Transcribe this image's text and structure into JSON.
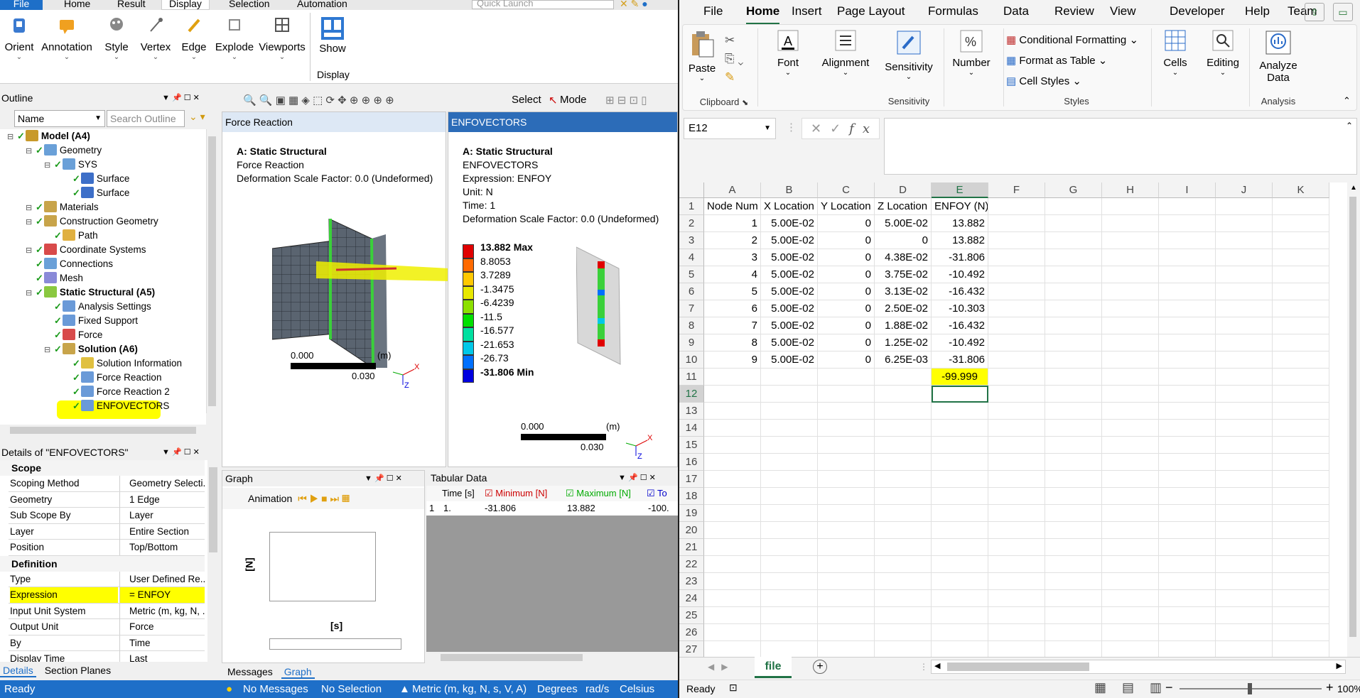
{
  "ansys": {
    "ribbon_tabs": [
      "File",
      "Home",
      "Result",
      "Display",
      "Selection",
      "Automation"
    ],
    "quick_launch_placeholder": "Quick Launch",
    "ribbon_buttons": [
      "Orient",
      "Annotation",
      "Style",
      "Vertex",
      "Edge",
      "Explode",
      "Viewports",
      "Show"
    ],
    "ribbon_group": "Display",
    "outline": {
      "title": "Outline",
      "name_filter": "Name",
      "search_placeholder": "Search Outline",
      "items": [
        {
          "label": "Model (A4)",
          "bold": true,
          "indent": 0,
          "color": "#c89a2a"
        },
        {
          "label": "Geometry",
          "indent": 1,
          "color": "#6aa0d8"
        },
        {
          "label": "SYS",
          "indent": 2,
          "color": "#6aa0d8"
        },
        {
          "label": "Surface",
          "indent": 3,
          "color": "#3d6fc8"
        },
        {
          "label": "Surface",
          "indent": 3,
          "color": "#3d6fc8"
        },
        {
          "label": "Materials",
          "indent": 1,
          "color": "#c8a44a"
        },
        {
          "label": "Construction Geometry",
          "indent": 1,
          "color": "#c8a44a"
        },
        {
          "label": "Path",
          "indent": 2,
          "color": "#e0b040"
        },
        {
          "label": "Coordinate Systems",
          "indent": 1,
          "color": "#d84a4a"
        },
        {
          "label": "Connections",
          "indent": 1,
          "color": "#6aa0d8"
        },
        {
          "label": "Mesh",
          "indent": 1,
          "color": "#8a8ad8"
        },
        {
          "label": "Static Structural (A5)",
          "bold": true,
          "indent": 1,
          "color": "#8ac840"
        },
        {
          "label": "Analysis Settings",
          "indent": 2,
          "color": "#6a9ad8"
        },
        {
          "label": "Fixed Support",
          "indent": 2,
          "color": "#6a9ad8"
        },
        {
          "label": "Force",
          "indent": 2,
          "color": "#d84a4a"
        },
        {
          "label": "Solution (A6)",
          "bold": true,
          "indent": 2,
          "color": "#c8a44a"
        },
        {
          "label": "Solution Information",
          "indent": 3,
          "color": "#e0c040"
        },
        {
          "label": "Force Reaction",
          "indent": 3,
          "color": "#6a9ad8"
        },
        {
          "label": "Force Reaction 2",
          "indent": 3,
          "color": "#6a9ad8"
        },
        {
          "label": "ENFOVECTORS",
          "indent": 3,
          "color": "#6a9ad8",
          "highlight": true
        }
      ]
    },
    "details": {
      "title": "Details of \"ENFOVECTORS\"",
      "sections": [
        {
          "name": "Scope",
          "rows": [
            {
              "k": "Scoping Method",
              "v": "Geometry Selecti..."
            },
            {
              "k": "Geometry",
              "v": "1 Edge"
            },
            {
              "k": "Sub Scope By",
              "v": "Layer"
            },
            {
              "k": "Layer",
              "v": "Entire Section"
            },
            {
              "k": "Position",
              "v": "Top/Bottom"
            }
          ]
        },
        {
          "name": "Definition",
          "rows": [
            {
              "k": "Type",
              "v": "User Defined Re..."
            },
            {
              "k": "Expression",
              "v": "= ENFOY",
              "highlight": true
            },
            {
              "k": "Input Unit System",
              "v": "Metric (m, kg, N, ..."
            },
            {
              "k": "Output Unit",
              "v": "Force"
            },
            {
              "k": "By",
              "v": "Time"
            },
            {
              "k": "Display Time",
              "v": "Last"
            }
          ]
        }
      ],
      "tabs": [
        "Details",
        "Section Planes"
      ]
    },
    "toolbar": {
      "select": "Select",
      "mode": "Mode"
    },
    "viewport1": {
      "tab": "Force Reaction",
      "lines": [
        "A: Static Structural",
        "Force Reaction",
        "Deformation Scale Factor: 0.0 (Undeformed)"
      ],
      "scale": [
        "0.000",
        "0.030",
        "(m)"
      ]
    },
    "viewport2": {
      "tab": "ENFOVECTORS",
      "lines": [
        "A: Static Structural",
        "ENFOVECTORS",
        "Expression: ENFOY",
        "Unit: N",
        "Time: 1",
        "Deformation Scale Factor: 0.0 (Undeformed)"
      ],
      "legend": [
        {
          "v": "13.882 Max",
          "c": "#e00000",
          "bold": true
        },
        {
          "v": "8.8053",
          "c": "#ff6a00"
        },
        {
          "v": "3.7289",
          "c": "#ffc800"
        },
        {
          "v": "-1.3475",
          "c": "#e8e800"
        },
        {
          "v": "-6.4239",
          "c": "#8ce000"
        },
        {
          "v": "-11.5",
          "c": "#00e000"
        },
        {
          "v": "-16.577",
          "c": "#00e0a0"
        },
        {
          "v": "-21.653",
          "c": "#00c8e8"
        },
        {
          "v": "-26.73",
          "c": "#0070ff"
        },
        {
          "v": "-31.806 Min",
          "c": "#0000e0",
          "bold": true
        }
      ],
      "scale": [
        "0.000",
        "0.030",
        "(m)"
      ]
    },
    "graph": {
      "title": "Graph",
      "animation": "Animation",
      "ylabel": "[N]",
      "xlabel": "[s]"
    },
    "tabular": {
      "title": "Tabular Data",
      "headers": [
        "Time [s]",
        "Minimum [N]",
        "Maximum [N]",
        "To"
      ],
      "row": [
        "1",
        "1.",
        "-31.806",
        "13.882",
        "-100."
      ]
    },
    "bottom_tabs": [
      "Messages",
      "Graph"
    ],
    "status": {
      "ready": "Ready",
      "messages": "No Messages",
      "selection": "No Selection",
      "units": "Metric (m, kg, N, s, V, A)",
      "angle": "Degrees",
      "rot": "rad/s",
      "temp": "Celsius"
    }
  },
  "excel": {
    "tabs": [
      "File",
      "Home",
      "Insert",
      "Page Layout",
      "Formulas",
      "Data",
      "Review",
      "View",
      "Developer",
      "Help",
      "Team"
    ],
    "active_tab": "Home",
    "groups": {
      "clipboard": "Clipboard",
      "paste": "Paste",
      "font": "Font",
      "alignment": "Alignment",
      "sensitivity": "Sensitivity",
      "sensitivity_group": "Sensitivity",
      "number": "Number",
      "cond_fmt": "Conditional Formatting",
      "fmt_table": "Format as Table",
      "cell_styles": "Cell Styles",
      "styles": "Styles",
      "cells": "Cells",
      "editing": "Editing",
      "analyze": "Analyze Data",
      "analysis": "Analysis"
    },
    "name_box": "E12",
    "columns": [
      "A",
      "B",
      "C",
      "D",
      "E",
      "F",
      "G",
      "H",
      "I",
      "J",
      "K"
    ],
    "rows": [
      [
        "Node Num",
        "X Location",
        "Y Location",
        "Z Location",
        "ENFOY (N)"
      ],
      [
        "1",
        "5.00E-02",
        "0",
        "5.00E-02",
        "13.882"
      ],
      [
        "2",
        "5.00E-02",
        "0",
        "0",
        "13.882"
      ],
      [
        "3",
        "5.00E-02",
        "0",
        "4.38E-02",
        "-31.806"
      ],
      [
        "4",
        "5.00E-02",
        "0",
        "3.75E-02",
        "-10.492"
      ],
      [
        "5",
        "5.00E-02",
        "0",
        "3.13E-02",
        "-16.432"
      ],
      [
        "6",
        "5.00E-02",
        "0",
        "2.50E-02",
        "-10.303"
      ],
      [
        "7",
        "5.00E-02",
        "0",
        "1.88E-02",
        "-16.432"
      ],
      [
        "8",
        "5.00E-02",
        "0",
        "1.25E-02",
        "-10.492"
      ],
      [
        "9",
        "5.00E-02",
        "0",
        "6.25E-03",
        "-31.806"
      ],
      [
        "",
        "",
        "",
        "",
        "-99.999"
      ]
    ],
    "row_numbers": [
      "1",
      "2",
      "3",
      "4",
      "5",
      "6",
      "7",
      "8",
      "9",
      "10",
      "11",
      "12",
      "13",
      "14",
      "15",
      "16",
      "17",
      "18",
      "19",
      "20",
      "21",
      "22",
      "23",
      "24",
      "25",
      "26",
      "27"
    ],
    "sheet": "file",
    "status": {
      "ready": "Ready",
      "zoom": "100%"
    }
  }
}
